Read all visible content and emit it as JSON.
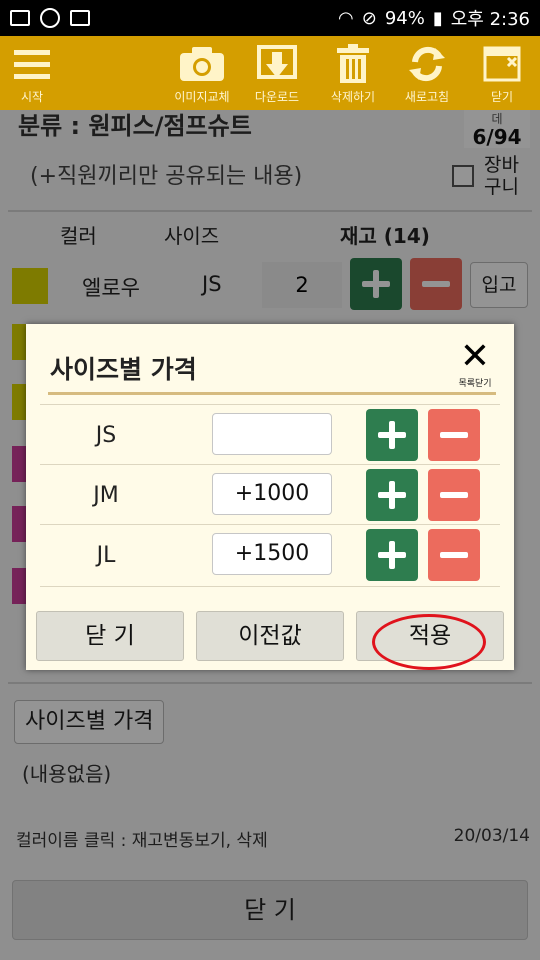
{
  "status_bar": {
    "battery": "94%",
    "time": "오후 2:36"
  },
  "toolbar": {
    "menu": "시작",
    "image": "이미지교체",
    "download": "다운로드",
    "delete": "삭제하기",
    "refresh": "새로고침",
    "close": "닫기"
  },
  "page": {
    "category": "분류 : 원피스/점프슈트",
    "counter_label": "데",
    "counter": "6/94",
    "note": "(+직원끼리만 공유되는 내용)",
    "cart_label": "장바\n구니",
    "headers": {
      "color": "컬러",
      "size": "사이즈",
      "stock": "재고 (14)"
    },
    "rows": [
      {
        "color_name": "엘로우",
        "size": "JS",
        "qty": "2",
        "in_label": "입고",
        "swatch": "#d9d400"
      }
    ],
    "extra_swatches": [
      "#d9d400",
      "#d9d400",
      "#cc3d99",
      "#cc3d99",
      "#cc3d99"
    ],
    "size_price_button": "사이즈별 가격",
    "size_price_content": "(내용없음)",
    "hint": "컬러이름 클릭 : 재고변동보기, 삭제",
    "date": "20/03/14",
    "close_button": "닫 기"
  },
  "modal": {
    "title": "사이즈별 가격",
    "close_label": "목록닫기",
    "rows": [
      {
        "size": "JS",
        "value": ""
      },
      {
        "size": "JM",
        "value": "+1000"
      },
      {
        "size": "JL",
        "value": "+1500"
      }
    ],
    "buttons": {
      "close": "닫 기",
      "previous": "이전값",
      "apply": "적용"
    }
  },
  "colors": {
    "toolbar": "#d49e00",
    "plus": "#2e7d4f",
    "minus": "#ec6b5d",
    "highlight_ring": "#e0131c"
  },
  "icons": [
    "menu-icon",
    "camera-icon",
    "download-icon",
    "trash-icon",
    "refresh-icon",
    "close-window-icon",
    "close-x-icon",
    "plus-icon",
    "minus-icon"
  ]
}
